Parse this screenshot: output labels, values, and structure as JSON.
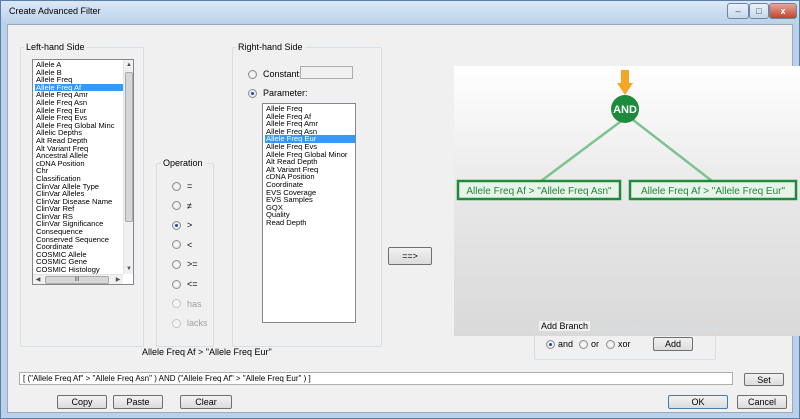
{
  "window": {
    "title": "Create Advanced Filter",
    "minimize_glyph": "–",
    "maximize_glyph": "□",
    "close_glyph": "x"
  },
  "left": {
    "label": "Left-hand Side",
    "items": [
      "Allele A",
      "Allele B",
      "Allele Freq",
      "Allele Freq Af",
      "Allele Freq Amr",
      "Allele Freq Asn",
      "Allele Freq Eur",
      "Allele Freq Evs",
      "Allele Freq Global Minc",
      "Allelic Depths",
      "Alt Read Depth",
      "Alt Variant Freq",
      "Ancestral Allele",
      "cDNA Position",
      "Chr",
      "Classification",
      "ClinVar Allele Type",
      "ClinVar Alleles",
      "ClinVar Disease Name",
      "ClinVar Ref",
      "ClinVar RS",
      "ClinVar Significance",
      "Consequence",
      "Conserved Sequence",
      "Coordinate",
      "COSMIC Allele",
      "COSMIC Gene",
      "COSMIC Histology"
    ],
    "selected_index": 3
  },
  "operation": {
    "label": "Operation",
    "options": [
      {
        "label": "=",
        "selected": false,
        "enabled": true
      },
      {
        "label": "≠",
        "selected": false,
        "enabled": true
      },
      {
        "label": ">",
        "selected": true,
        "enabled": true
      },
      {
        "label": "<",
        "selected": false,
        "enabled": true
      },
      {
        "label": ">=",
        "selected": false,
        "enabled": true
      },
      {
        "label": "<=",
        "selected": false,
        "enabled": true
      },
      {
        "label": "has",
        "selected": false,
        "enabled": false
      },
      {
        "label": "lacks",
        "selected": false,
        "enabled": false
      }
    ]
  },
  "right": {
    "label": "Right-hand Side",
    "constant_label": "Constant:",
    "constant_value": "",
    "parameter_label": "Parameter:",
    "mode": "parameter",
    "items": [
      "Allele Freq",
      "Allele Freq Af",
      "Allele Freq Amr",
      "Allele Freq Asn",
      "Allele Freq Eur",
      "Allele Freq Evs",
      "Allele Freq Global Minor",
      "Alt Read Depth",
      "Alt Variant Freq",
      "cDNA Position",
      "Coordinate",
      "EVS Coverage",
      "EVS Samples",
      "GQX",
      "Quality",
      "Read Depth"
    ],
    "selected_index": 4
  },
  "arrow_button": "==>",
  "preview_text": "Allele Freq Af > \"Allele Freq Eur\"",
  "tree": {
    "root": "AND",
    "left_leaf": "Allele Freq Af > \"Allele Freq Asn\"",
    "right_leaf": "Allele Freq Af > \"Allele Freq Eur\"",
    "colors": {
      "node": "#1e8a3c",
      "edge": "#7cc48f",
      "pointer": "#f5a623",
      "canvas": "#dcdcdc"
    }
  },
  "branch": {
    "label": "Add Branch",
    "options": [
      {
        "label": "and",
        "selected": true
      },
      {
        "label": "or",
        "selected": false
      },
      {
        "label": "xor",
        "selected": false
      }
    ],
    "add_button": "Add"
  },
  "expression": "[ (\"Allele Freq Af\" > \"Allele Freq Asn\" ) AND (\"Allele Freq Af\" > \"Allele Freq Eur\" ) ]",
  "buttons": {
    "set": "Set",
    "copy": "Copy",
    "paste": "Paste",
    "clear": "Clear",
    "ok": "OK",
    "cancel": "Cancel"
  }
}
